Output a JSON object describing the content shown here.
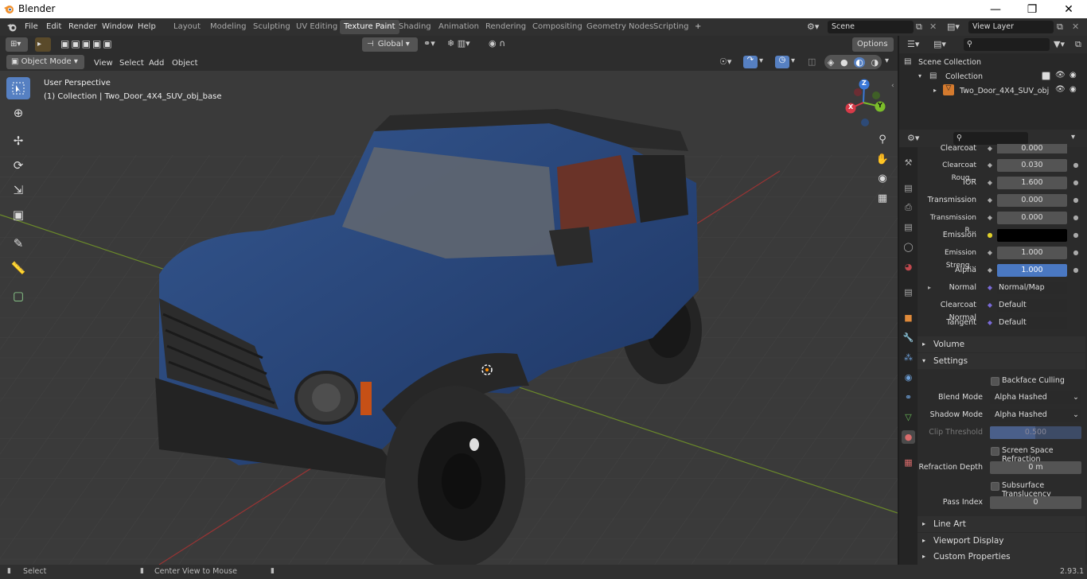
{
  "window": {
    "title": "Blender"
  },
  "menus": [
    "File",
    "Edit",
    "Render",
    "Window",
    "Help"
  ],
  "workspaces": [
    "Layout",
    "Modeling",
    "Sculpting",
    "UV Editing",
    "Texture Paint",
    "Shading",
    "Animation",
    "Rendering",
    "Compositing",
    "Geometry Nodes",
    "Scripting"
  ],
  "active_workspace": "Texture Paint",
  "scene": {
    "name": "Scene",
    "view_layer": "View Layer"
  },
  "viewport": {
    "mode": "Object Mode",
    "menu": [
      "View",
      "Select",
      "Add",
      "Object"
    ],
    "transform_orientation": "Global",
    "options_label": "Options",
    "perspective_label": "User Perspective",
    "collection_label": "(1) Collection | Two_Door_4X4_SUV_obj_base",
    "gizmo": {
      "x": "X",
      "y": "Y",
      "z": "Z"
    }
  },
  "outliner": {
    "scene_collection": "Scene Collection",
    "collection": "Collection",
    "object": "Two_Door_4X4_SUV_obj"
  },
  "properties": {
    "rows": [
      {
        "label": "Clearcoat",
        "value": "0.000"
      },
      {
        "label": "Clearcoat Roug...",
        "value": "0.030"
      },
      {
        "label": "IOR",
        "value": "1.600"
      },
      {
        "label": "Transmission",
        "value": "0.000"
      },
      {
        "label": "Transmission R...",
        "value": "0.000"
      },
      {
        "label": "Emission",
        "value": ""
      },
      {
        "label": "Emission Streng...",
        "value": "1.000"
      },
      {
        "label": "Alpha",
        "value": "1.000"
      },
      {
        "label": "Normal",
        "value": "Normal/Map"
      },
      {
        "label": "Clearcoat Normal",
        "value": "Default"
      },
      {
        "label": "Tangent",
        "value": "Default"
      }
    ],
    "sections": {
      "volume": "Volume",
      "settings": "Settings",
      "line_art": "Line Art",
      "viewport_display": "Viewport Display",
      "custom_properties": "Custom Properties"
    },
    "settings": {
      "backface_culling": "Backface Culling",
      "blend_mode_label": "Blend Mode",
      "blend_mode": "Alpha Hashed",
      "shadow_mode_label": "Shadow Mode",
      "shadow_mode": "Alpha Hashed",
      "clip_threshold_label": "Clip Threshold",
      "clip_threshold": "0.500",
      "ssr": "Screen Space Refraction",
      "refraction_depth_label": "Refraction Depth",
      "refraction_depth": "0 m",
      "subsurface": "Subsurface Translucency",
      "pass_index_label": "Pass Index",
      "pass_index": "0"
    }
  },
  "statusbar": {
    "left": "Select",
    "middle": "Center View to Mouse",
    "version": "2.93.1"
  },
  "colors": {
    "accent": "#5680c2",
    "alpha_bar": "#4a78c2",
    "emission": "#000000"
  }
}
